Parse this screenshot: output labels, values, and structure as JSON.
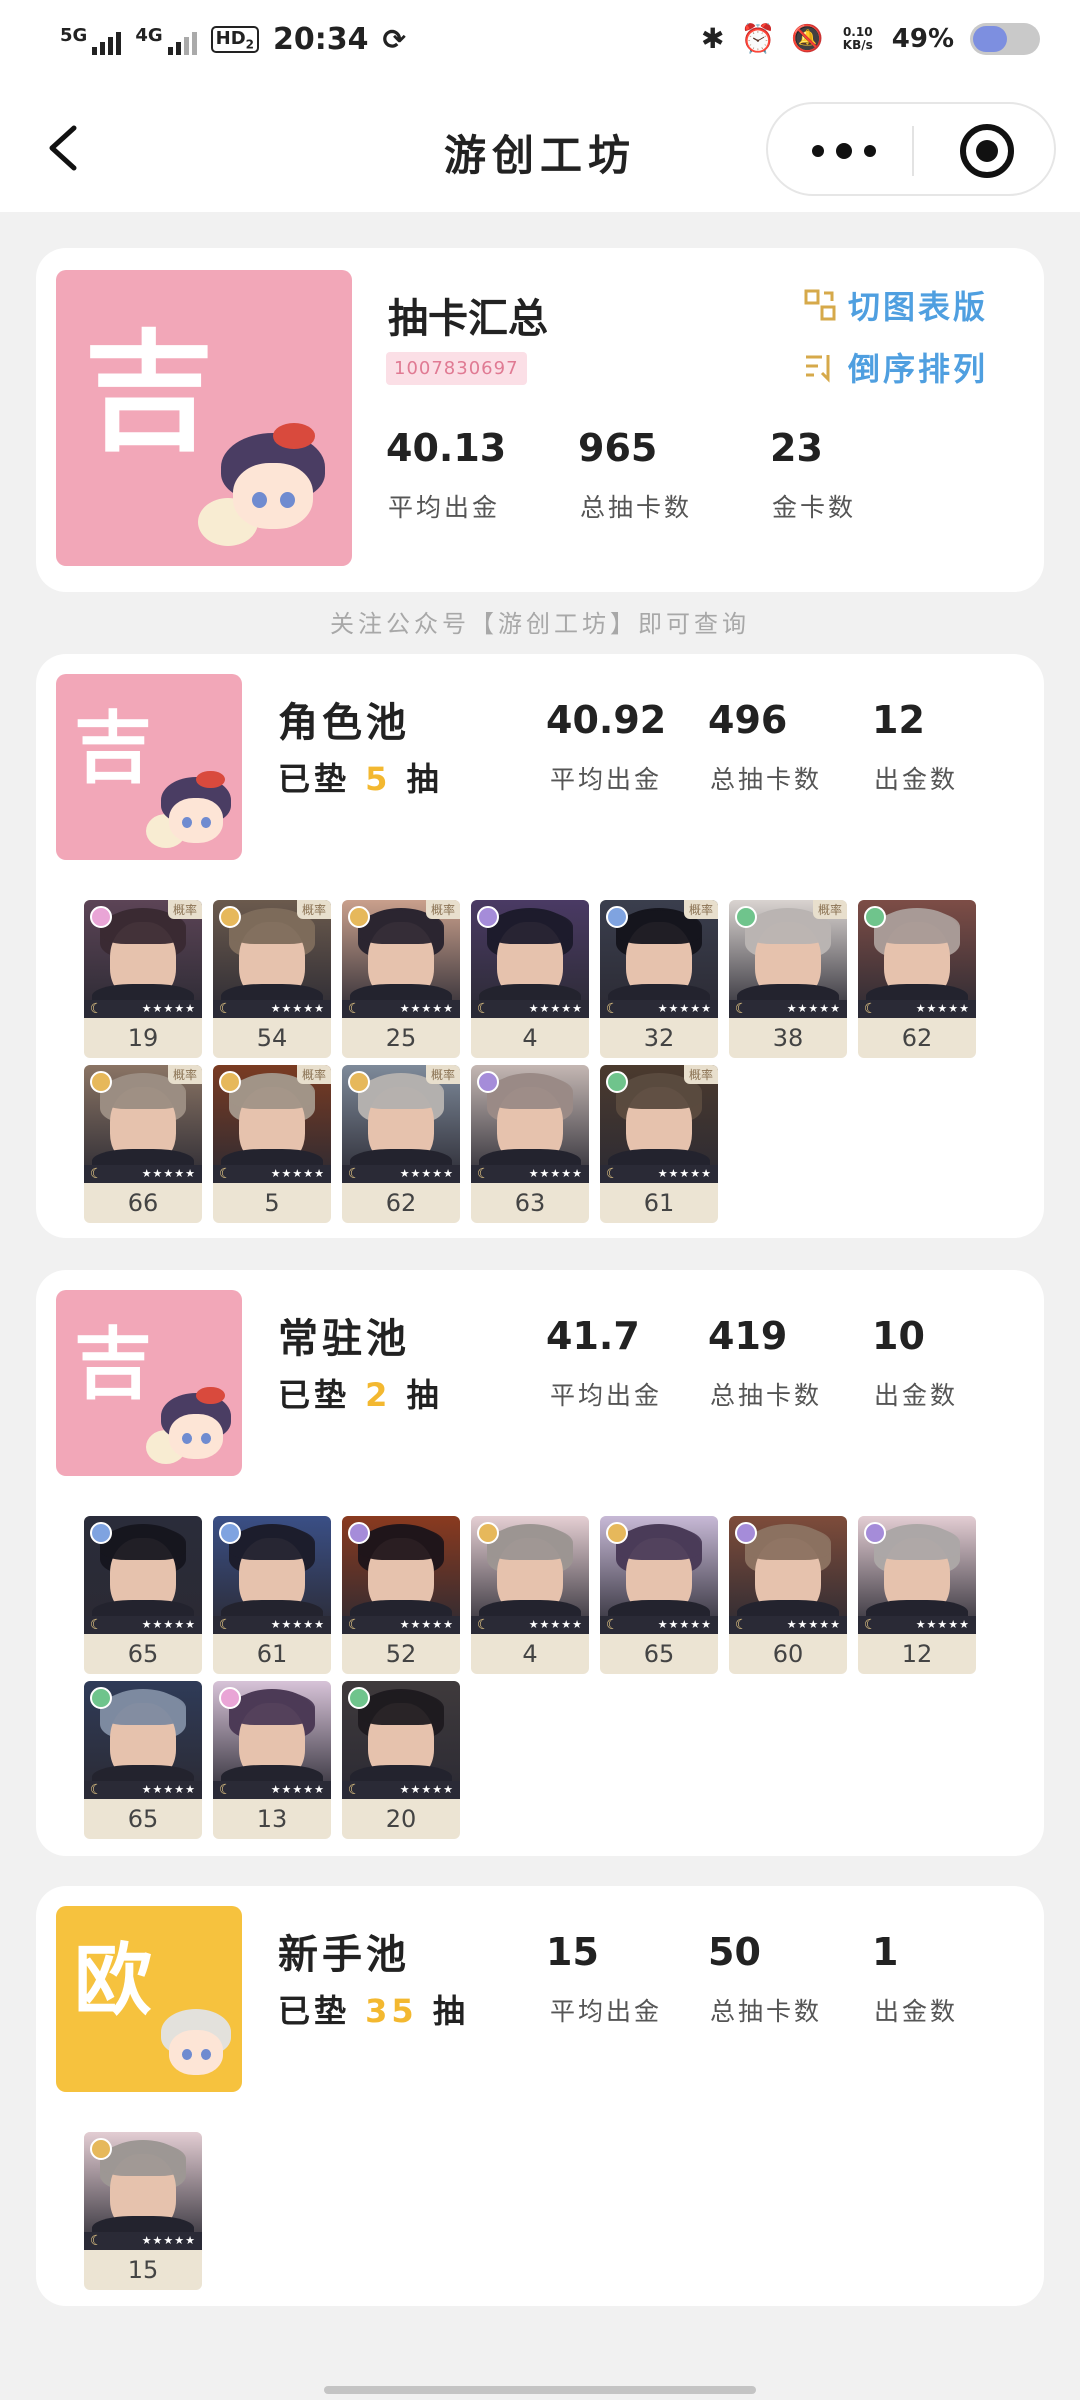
{
  "status_bar": {
    "time": "20:34",
    "net1": "5G",
    "net2": "4G",
    "hd": "HD",
    "hd_sub": "2",
    "speed": "0.10 KB/s",
    "battery": "49%"
  },
  "nav": {
    "title": "游创工坊"
  },
  "summary": {
    "avatar_char": "吉",
    "title": "抽卡汇总",
    "uid": "1007830697",
    "actions": [
      {
        "label": "切图表版",
        "icon": "switch-view-icon"
      },
      {
        "label": "倒序排列",
        "icon": "sort-desc-icon"
      }
    ],
    "stats": [
      {
        "value": "40.13",
        "label": "平均出金"
      },
      {
        "value": "965",
        "label": "总抽卡数"
      },
      {
        "value": "23",
        "label": "金卡数"
      }
    ]
  },
  "hint": "关注公众号【游创工坊】即可查询",
  "pools": [
    {
      "avatar_char": "吉",
      "avatar_color": "#f2a7b8",
      "name": "角色池",
      "pad_prefix": "已垫",
      "pad_count": "5",
      "pad_suffix": "抽",
      "stats": [
        {
          "value": "40.92",
          "label": "平均出金"
        },
        {
          "value": "496",
          "label": "总抽卡数"
        },
        {
          "value": "12",
          "label": "出金数"
        }
      ],
      "cards": [
        {
          "count": "19",
          "badge": "#e9a5d6",
          "rate": "概率",
          "hair": "#3a2a33",
          "bg": "#5c4456"
        },
        {
          "count": "54",
          "badge": "#e6b85b",
          "rate": "概率",
          "hair": "#7d6b5b",
          "bg": "#6b5a4d"
        },
        {
          "count": "25",
          "badge": "#e6b85b",
          "rate": "概率",
          "hair": "#2b2530",
          "bg": "#c9a08c"
        },
        {
          "count": "4",
          "badge": "#a58cd9",
          "rate": "",
          "hair": "#1d1b2c",
          "bg": "#4a3a64"
        },
        {
          "count": "32",
          "badge": "#7fa3e0",
          "rate": "概率",
          "hair": "#15151d",
          "bg": "#3a3e4d"
        },
        {
          "count": "38",
          "badge": "#6fc48c",
          "rate": "概率",
          "hair": "#b9b4b2",
          "bg": "#d9d3d0"
        },
        {
          "count": "62",
          "badge": "#6fc48c",
          "rate": "",
          "hair": "#a89a96",
          "bg": "#7d4d46"
        },
        {
          "count": "66",
          "badge": "#e6b85b",
          "rate": "概率",
          "hair": "#9b8d82",
          "bg": "#8a7464"
        },
        {
          "count": "5",
          "badge": "#e6b85b",
          "rate": "概率",
          "hair": "#a19387",
          "bg": "#7a3b22"
        },
        {
          "count": "62",
          "badge": "#e6b85b",
          "rate": "概率",
          "hair": "#b3b0ae",
          "bg": "#7e8a9a"
        },
        {
          "count": "63",
          "badge": "#a58cd9",
          "rate": "",
          "hair": "#9a8a86",
          "bg": "#c4b7b3"
        },
        {
          "count": "61",
          "badge": "#6fc48c",
          "rate": "概率",
          "hair": "#5a4a3e",
          "bg": "#4b3a2e"
        }
      ]
    },
    {
      "avatar_char": "吉",
      "avatar_color": "#f2a7b8",
      "name": "常驻池",
      "pad_prefix": "已垫",
      "pad_count": "2",
      "pad_suffix": "抽",
      "stats": [
        {
          "value": "41.7",
          "label": "平均出金"
        },
        {
          "value": "419",
          "label": "总抽卡数"
        },
        {
          "value": "10",
          "label": "出金数"
        }
      ],
      "cards": [
        {
          "count": "65",
          "badge": "#7fa3e0",
          "rate": "",
          "hair": "#16161f",
          "bg": "#2a2c3a"
        },
        {
          "count": "61",
          "badge": "#7fa3e0",
          "rate": "",
          "hair": "#1c1d2c",
          "bg": "#3a4f86"
        },
        {
          "count": "52",
          "badge": "#a58cd9",
          "rate": "",
          "hair": "#20151a",
          "bg": "#8a3a1f"
        },
        {
          "count": "4",
          "badge": "#e6b85b",
          "rate": "",
          "hair": "#9c9592",
          "bg": "#e5cfd3"
        },
        {
          "count": "65",
          "badge": "#e6b85b",
          "rate": "",
          "hair": "#4a3b58",
          "bg": "#c7b9d6"
        },
        {
          "count": "60",
          "badge": "#a58cd9",
          "rate": "",
          "hair": "#8b7160",
          "bg": "#7e4c3a"
        },
        {
          "count": "12",
          "badge": "#a58cd9",
          "rate": "",
          "hair": "#aca7a6",
          "bg": "#e3cdd3"
        },
        {
          "count": "65",
          "badge": "#6fc48c",
          "rate": "",
          "hair": "#7d8aa0",
          "bg": "#2f3b58"
        },
        {
          "count": "13",
          "badge": "#e9a5d6",
          "rate": "",
          "hair": "#4c3a56",
          "bg": "#d7c3d8"
        },
        {
          "count": "20",
          "badge": "#6fc48c",
          "rate": "",
          "hair": "#1f1b20",
          "bg": "#3f3a3c"
        }
      ]
    },
    {
      "avatar_char": "欧",
      "avatar_color": "#f6c23e",
      "name": "新手池",
      "pad_prefix": "已垫",
      "pad_count": "35",
      "pad_suffix": "抽",
      "stats": [
        {
          "value": "15",
          "label": "平均出金"
        },
        {
          "value": "50",
          "label": "总抽卡数"
        },
        {
          "value": "1",
          "label": "出金数"
        }
      ],
      "cards": [
        {
          "count": "15",
          "badge": "#e6b85b",
          "rate": "",
          "hair": "#9d9794",
          "bg": "#e3cdd3"
        }
      ]
    }
  ]
}
